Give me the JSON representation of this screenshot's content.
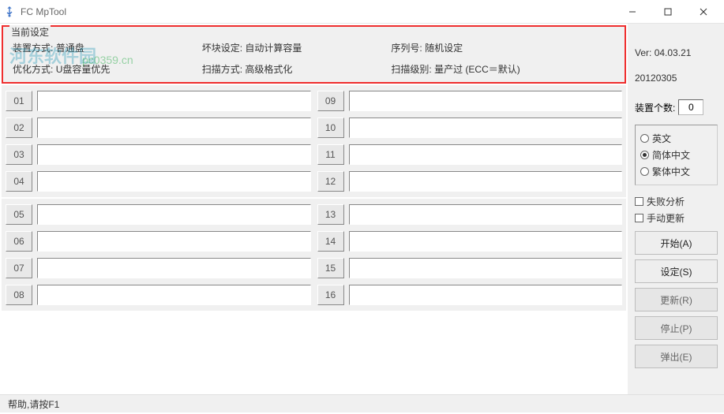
{
  "title": "FC MpTool",
  "watermark": {
    "brand": "河东软件园",
    "url": "pc0359.cn"
  },
  "settings": {
    "legend": "当前设定",
    "row1": {
      "col1_label": "装置方式:",
      "col1_value": "普通盘",
      "col2_label": "坏块设定:",
      "col2_value": "自动计算容量",
      "col3_label": "序列号:",
      "col3_value": "随机设定"
    },
    "row2": {
      "col1_label": "优化方式:",
      "col1_value": "U盘容量优先",
      "col2_label": "扫描方式:",
      "col2_value": "高级格式化",
      "col3_label": "扫描级别:",
      "col3_value": "量产过 (ECC＝默认)"
    }
  },
  "slots": {
    "group1_left": [
      "01",
      "02",
      "03",
      "04"
    ],
    "group1_right": [
      "09",
      "10",
      "11",
      "12"
    ],
    "group2_left": [
      "05",
      "06",
      "07",
      "08"
    ],
    "group2_right": [
      "13",
      "14",
      "15",
      "16"
    ]
  },
  "side": {
    "version_label": "Ver:",
    "version_value": "04.03.21",
    "date": "20120305",
    "count_label": "装置个数:",
    "count_value": "0",
    "lang": {
      "english": "英文",
      "simp": "简体中文",
      "trad": "繁体中文",
      "selected": "简体中文"
    },
    "checks": {
      "fail_analysis": "失败分析",
      "manual_update": "手动更新"
    },
    "buttons": {
      "start": "开始(A)",
      "settings": "设定(S)",
      "update": "更新(R)",
      "stop": "停止(P)",
      "eject": "弹出(E)"
    }
  },
  "statusbar": "帮助,请按F1"
}
